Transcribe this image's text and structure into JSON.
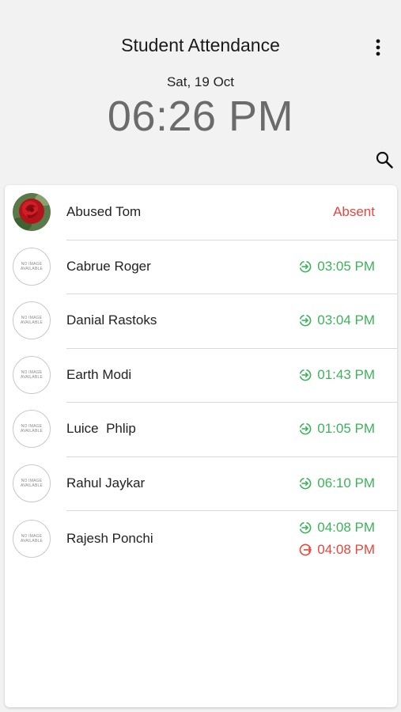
{
  "header": {
    "title": "Student Attendance",
    "date": "Sat, 19 Oct",
    "time": "06:26 PM",
    "menu_icon": "more-vert-icon",
    "search_icon": "search-icon"
  },
  "colors": {
    "check_in": "#3cb35a",
    "check_out": "#e8453c",
    "absent": "#e8453c"
  },
  "no_image_text": [
    "NO IMAGE",
    "AVAILABLE"
  ],
  "students": [
    {
      "name": "Abused Tom",
      "status": "Absent",
      "avatar": "rose-photo"
    },
    {
      "name": "Cabrue Roger",
      "in_time": "03:05 PM",
      "avatar": "no-image"
    },
    {
      "name": "Danial Rastoks",
      "in_time": "03:04 PM",
      "avatar": "no-image"
    },
    {
      "name": "Earth Modi",
      "in_time": "01:43 PM",
      "avatar": "no-image"
    },
    {
      "name": "Luice  Phlip",
      "in_time": "01:05 PM",
      "avatar": "no-image"
    },
    {
      "name": "Rahul Jaykar",
      "in_time": "06:10 PM",
      "avatar": "no-image"
    },
    {
      "name": "Rajesh Ponchi",
      "in_time": "04:08 PM",
      "out_time": "04:08 PM",
      "avatar": "no-image"
    }
  ]
}
